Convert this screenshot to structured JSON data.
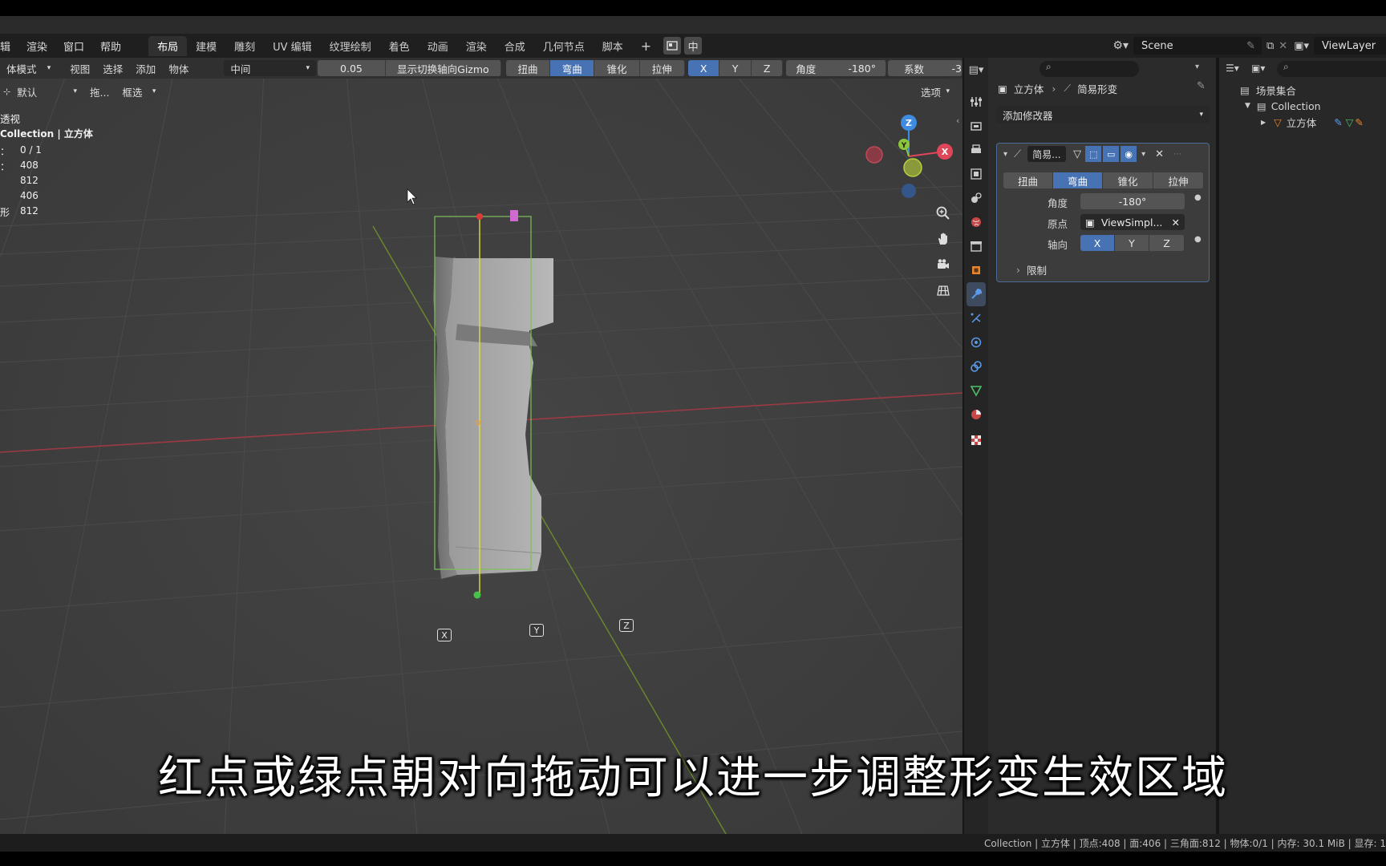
{
  "menu": {
    "items": [
      "辑",
      "渲染",
      "窗口",
      "帮助"
    ],
    "workspaces": [
      "布局",
      "建模",
      "雕刻",
      "UV 编辑",
      "纹理绘制",
      "着色",
      "动画",
      "渲染",
      "合成",
      "几何节点",
      "脚本"
    ],
    "active_workspace": "布局",
    "add_tab": "+",
    "scene_label": "Scene",
    "viewlayer_label": "ViewLayer",
    "btn_zh": "中"
  },
  "viewport_header": {
    "mode": "体模式",
    "menus": [
      "视图",
      "选择",
      "添加",
      "物体"
    ],
    "pivot": "中间",
    "value": "0.05",
    "gizmo_toggle": "显示切换轴向Gizmo",
    "deform_modes": [
      "扭曲",
      "弯曲",
      "锥化",
      "拉伸"
    ],
    "active_deform": "弯曲",
    "axes": [
      "X",
      "Y",
      "Z"
    ],
    "active_axis": "X",
    "angle_label": "角度",
    "angle_value": "-180°",
    "factor_label": "系数",
    "factor_value": "-3"
  },
  "viewport_header2": {
    "orientation": "默认",
    "drag": "拖...",
    "select_mode": "框选",
    "options": "选项"
  },
  "overlay": {
    "view_name": "透视",
    "collection_path": "Collection | 立方体",
    "stats": [
      {
        "label": "：",
        "value": "0 / 1"
      },
      {
        "label": "：",
        "value": "408"
      },
      {
        "label": "",
        "value": "812"
      },
      {
        "label": "",
        "value": "406"
      },
      {
        "label": "形",
        "value": "812"
      }
    ]
  },
  "gizmo": {
    "z": "Z",
    "y": "Y",
    "x": "X"
  },
  "scene_axes": {
    "x": "X",
    "y": "Y",
    "z": "Z"
  },
  "properties": {
    "breadcrumb_object": "立方体",
    "breadcrumb_modifier": "简易形变",
    "add_modifier": "添加修改器",
    "modifier_name": "简易...",
    "tabs": [
      "扭曲",
      "弯曲",
      "锥化",
      "拉伸"
    ],
    "active_tab": "弯曲",
    "angle_label": "角度",
    "angle_value": "-180°",
    "origin_label": "原点",
    "origin_value": "ViewSimpl...",
    "axis_label": "轴向",
    "axes": [
      "X",
      "Y",
      "Z"
    ],
    "active_axis": "X",
    "limits_label": "限制"
  },
  "outliner": {
    "scene_collection": "场景集合",
    "collection": "Collection",
    "object": "立方体"
  },
  "statusbar": {
    "text": "Collection | 立方体 | 顶点:408 | 面:406 | 三角面:812 | 物体:0/1 | 内存: 30.1 MiB | 显存: 1"
  },
  "subtitle": "红点或绿点朝对向拖动可以进一步调整形变生效区域",
  "colors": {
    "accent": "#4772b3",
    "axis_x": "#e0465a",
    "axis_y": "#8cc43a",
    "axis_z": "#3f8be0"
  }
}
